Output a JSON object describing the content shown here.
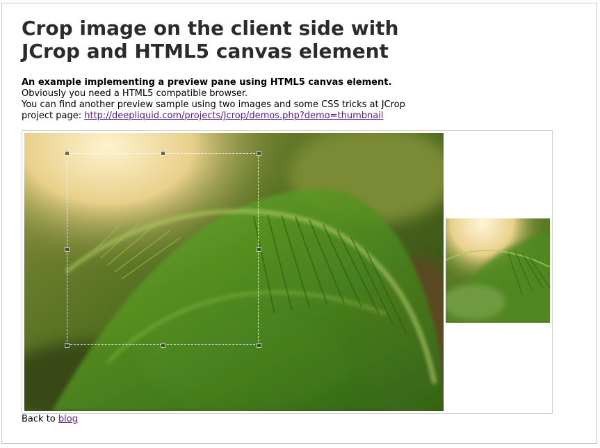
{
  "page": {
    "title": "Crop image on the client side with JCrop and HTML5 canvas element"
  },
  "intro": {
    "bold_line": "An example implementing a preview pane using HTML5 canvas element.",
    "line2": "Obviously you need a HTML5 compatible browser.",
    "line3": "You can find another preview sample using two images and some CSS tricks at JCrop",
    "line4_prefix": "project page: ",
    "link_text": "http://deepliquid.com/projects/Jcrop/demos.php?demo=thumbnail"
  },
  "footer": {
    "back_prefix": "Back to ",
    "blog_link": "blog"
  },
  "colors": {
    "title": "#2b2b2b",
    "link": "#551a8b",
    "leaf_green": "#3f7a1c",
    "highlight": "#f6e6b8"
  }
}
